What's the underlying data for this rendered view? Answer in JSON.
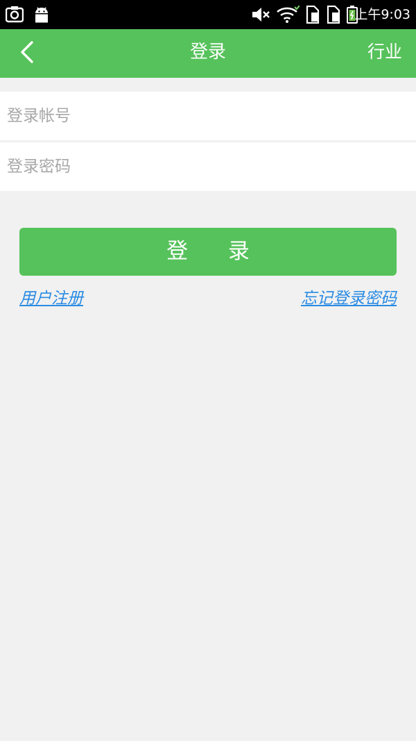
{
  "status_bar": {
    "time": "上午9:03",
    "icons": [
      "screenshot-icon",
      "android-icon",
      "mute-icon",
      "wifi-icon",
      "sim1-icon",
      "sim2-icon",
      "battery-icon"
    ]
  },
  "header": {
    "title": "登录",
    "right_action": "行业",
    "back_icon": "chevron-left-icon"
  },
  "form": {
    "account_placeholder": "登录帐号",
    "account_value": "",
    "password_placeholder": "登录密码",
    "password_value": "",
    "login_label": "登 录"
  },
  "links": {
    "register": "用户注册",
    "forgot_password": "忘记登录密码"
  },
  "colors": {
    "accent": "#56c25b",
    "link": "#2a8be3",
    "background": "#f1f1f1"
  }
}
